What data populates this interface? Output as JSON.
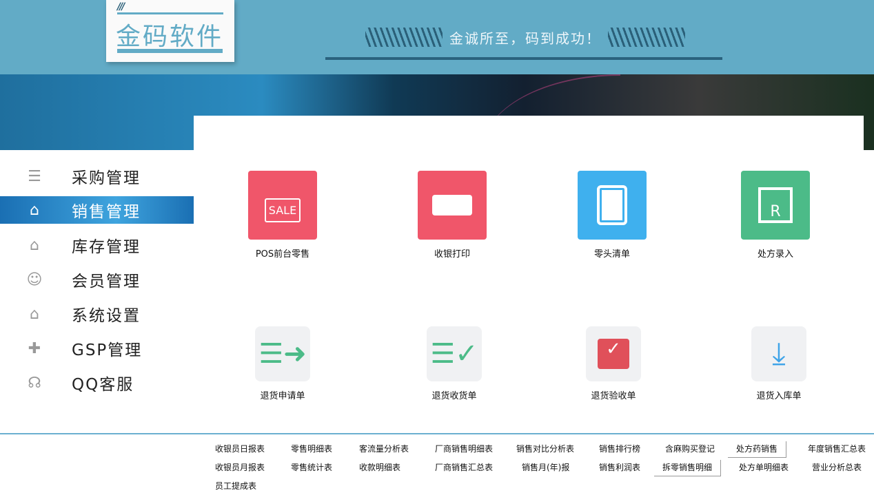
{
  "header": {
    "logo_text": "金码软件",
    "slogan": "金诚所至，码到成功！"
  },
  "sidebar": {
    "items": [
      {
        "label": "采购管理",
        "icon": "document-icon"
      },
      {
        "label": "销售管理",
        "icon": "building-icon",
        "active": true
      },
      {
        "label": "库存管理",
        "icon": "building-icon"
      },
      {
        "label": "会员管理",
        "icon": "member-icon"
      },
      {
        "label": "系统设置",
        "icon": "building-icon"
      },
      {
        "label": "GSP管理",
        "icon": "medical-kit-icon"
      },
      {
        "label": "QQ客服",
        "icon": "headset-icon"
      }
    ]
  },
  "tiles": [
    {
      "label": "POS前台零售",
      "icon": "sale-sign-icon",
      "color": "#f0566a"
    },
    {
      "label": "收银打印",
      "icon": "printer-icon",
      "color": "#f0566a"
    },
    {
      "label": "零头清单",
      "icon": "calculator-icon",
      "color": "#3fb0ee"
    },
    {
      "label": "处方录入",
      "icon": "prescription-icon",
      "color": "#4cbb88"
    },
    {
      "label": "退货申请单",
      "icon": "list-arrow-icon",
      "color": "#4cbb88"
    },
    {
      "label": "退货收货单",
      "icon": "list-check-icon",
      "color": "#4cbb88"
    },
    {
      "label": "退货验收单",
      "icon": "inbox-check-icon",
      "color": "#e0505a"
    },
    {
      "label": "退货入库单",
      "icon": "download-icon",
      "color": "#3fa4e8"
    }
  ],
  "reports": [
    [
      "收银员日报表",
      "零售明细表",
      "客流量分析表",
      "厂商销售明细表",
      "销售对比分析表",
      "销售排行榜",
      "含麻购买登记",
      "处方药销售",
      "年度销售汇总表"
    ],
    [
      "收银员月报表",
      "零售统计表",
      "收款明细表",
      "厂商销售汇总表",
      "销售月(年)报",
      "销售利润表",
      "拆零销售明细",
      "处方单明细表",
      "营业分析总表"
    ],
    [
      "员工提成表"
    ]
  ]
}
